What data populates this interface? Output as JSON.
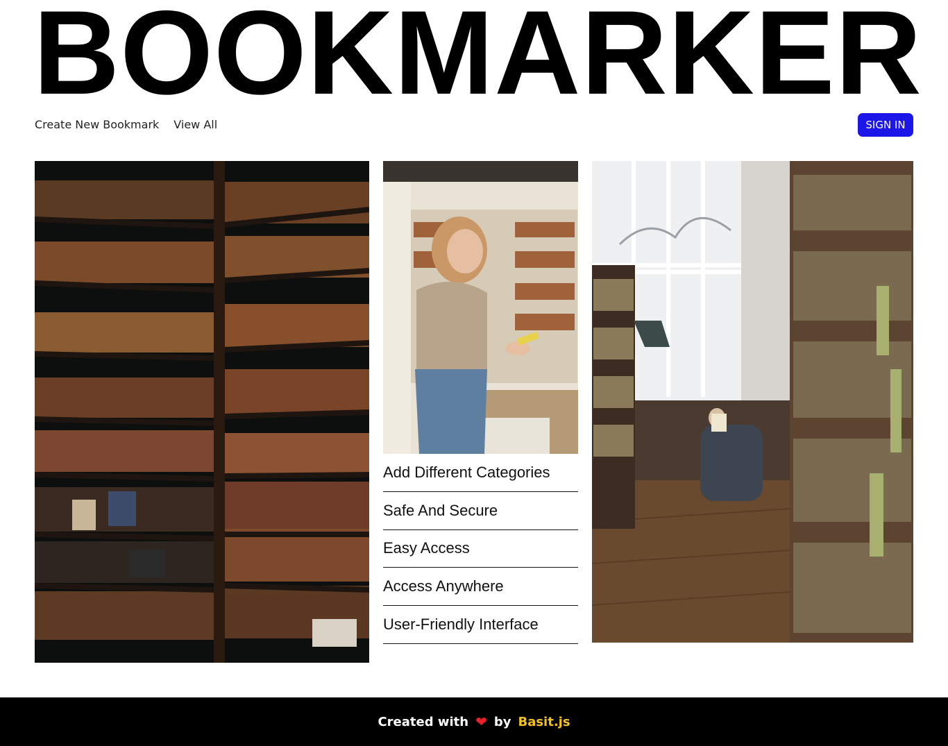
{
  "brand": {
    "title": "BOOKMARKER"
  },
  "nav": {
    "items": [
      "Create New Bookmark",
      "View All"
    ],
    "signin_label": "SIGN IN"
  },
  "features": [
    "Add Different Categories",
    "Safe And Secure",
    "Easy Access",
    "Access Anywhere",
    "User-Friendly Interface"
  ],
  "footer": {
    "prefix": "Created with",
    "by": "by",
    "author": "Basit.js"
  },
  "colors": {
    "accent": "#1c16e8",
    "footer_bg": "#000000",
    "heart": "#e8212e",
    "author": "#f2c21b"
  },
  "icons": {
    "heart": "heart-icon"
  }
}
